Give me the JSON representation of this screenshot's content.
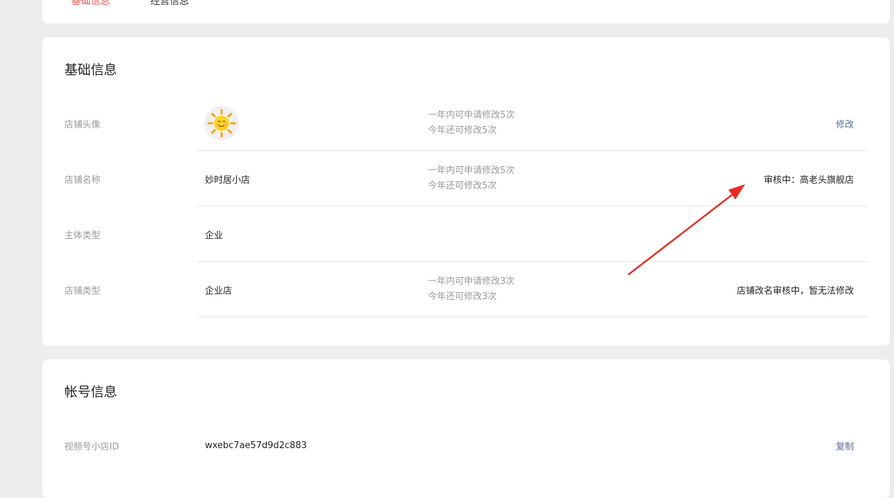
{
  "tabs": [
    {
      "label": "基础信息",
      "active": true
    },
    {
      "label": "经营信息",
      "active": false
    }
  ],
  "basic_section": {
    "title": "基础信息",
    "rows": [
      {
        "label": "店铺头像",
        "value": "",
        "note_line1": "一年内可申请修改5次",
        "note_line2": "今年还可修改5次",
        "action": "修改"
      },
      {
        "label": "店铺名称",
        "value": "妙时居小店",
        "note_line1": "一年内可申请修改5次",
        "note_line2": "今年还可修改5次",
        "action": "审核中：高老头旗舰店"
      },
      {
        "label": "主体类型",
        "value": "企业"
      },
      {
        "label": "店铺类型",
        "value": "企业店",
        "note_line1": "一年内可申请修改3次",
        "note_line2": "今年还可修改3次",
        "action": "店铺改名审核中，暂无法修改"
      }
    ]
  },
  "account_section": {
    "title": "帐号信息",
    "rows": [
      {
        "label": "视频号小店ID",
        "value": "wxebc7ae57d9d2c883",
        "action": "复制"
      }
    ]
  },
  "colors": {
    "accent_tab": "#fa5151",
    "link": "#576b95",
    "annotation_arrow": "#ee2a1f"
  },
  "icons": {
    "avatar": "sun-cartoon-icon"
  }
}
